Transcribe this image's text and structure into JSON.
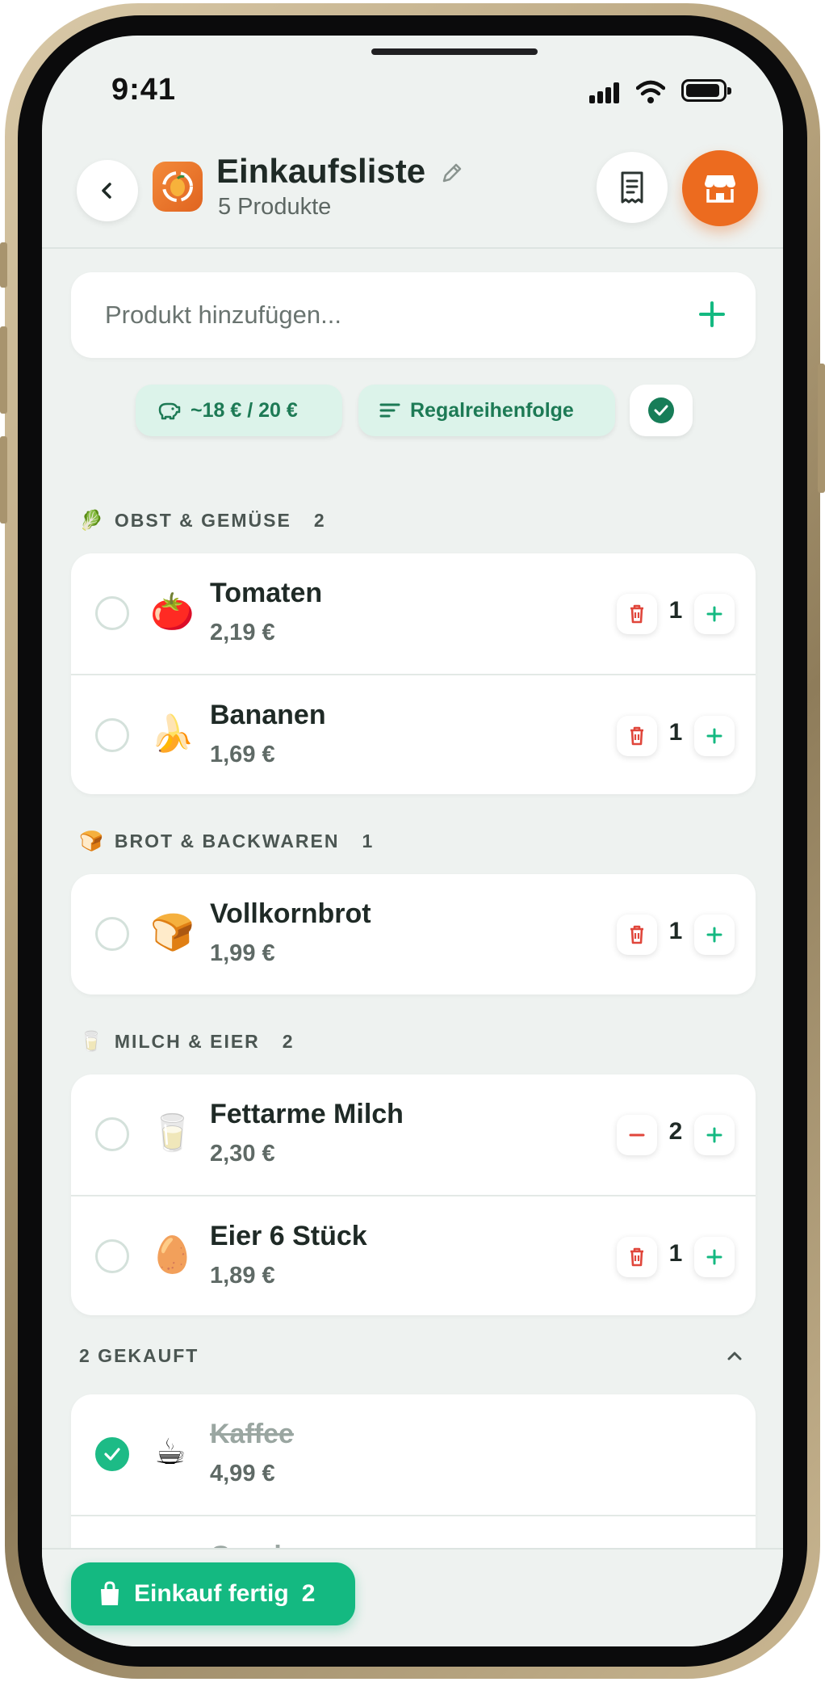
{
  "status_bar": {
    "time": "9:41"
  },
  "header": {
    "title": "Einkaufsliste",
    "subtitle": "5 Produkte"
  },
  "add_input": {
    "placeholder": "Produkt hinzufügen..."
  },
  "chips": {
    "budget": "~18 € / 20 €",
    "sort": "Regalreihenfolge"
  },
  "sections": [
    {
      "emoji": "🥬",
      "title": "OBST & GEMÜSE",
      "count": "2",
      "items": [
        {
          "emoji": "🍅",
          "name": "Tomaten",
          "price": "2,19 €",
          "qty": "1",
          "minus_icon": "trash-icon"
        },
        {
          "emoji": "🍌",
          "name": "Bananen",
          "price": "1,69 €",
          "qty": "1",
          "minus_icon": "trash-icon"
        }
      ]
    },
    {
      "emoji": "🍞",
      "title": "BROT & BACKWAREN",
      "count": "1",
      "items": [
        {
          "emoji": "🍞",
          "name": "Vollkornbrot",
          "price": "1,99 €",
          "qty": "1",
          "minus_icon": "trash-icon"
        }
      ]
    },
    {
      "emoji": "🥛",
      "title": "MILCH & EIER",
      "count": "2",
      "items": [
        {
          "emoji": "🥛",
          "name": "Fettarme Milch",
          "price": "2,30 €",
          "qty": "2",
          "minus_icon": "minus-icon"
        },
        {
          "emoji": "🥚",
          "name": "Eier 6 Stück",
          "price": "1,89 €",
          "qty": "1",
          "minus_icon": "trash-icon"
        }
      ]
    }
  ],
  "bought": {
    "title": "2 GEKAUFT",
    "items": [
      {
        "emoji": "☕",
        "name": "Kaffee",
        "price": "4,99 €"
      },
      {
        "emoji": "🧀",
        "name": "Gouda",
        "price": ""
      }
    ]
  },
  "footer": {
    "finish_label": "Einkauf fertig",
    "finish_count": "2"
  },
  "colors": {
    "accent_green": "#14b981",
    "brand_orange": "#ec6b1f",
    "delete_red": "#e0463b",
    "background": "#eef2f0"
  }
}
